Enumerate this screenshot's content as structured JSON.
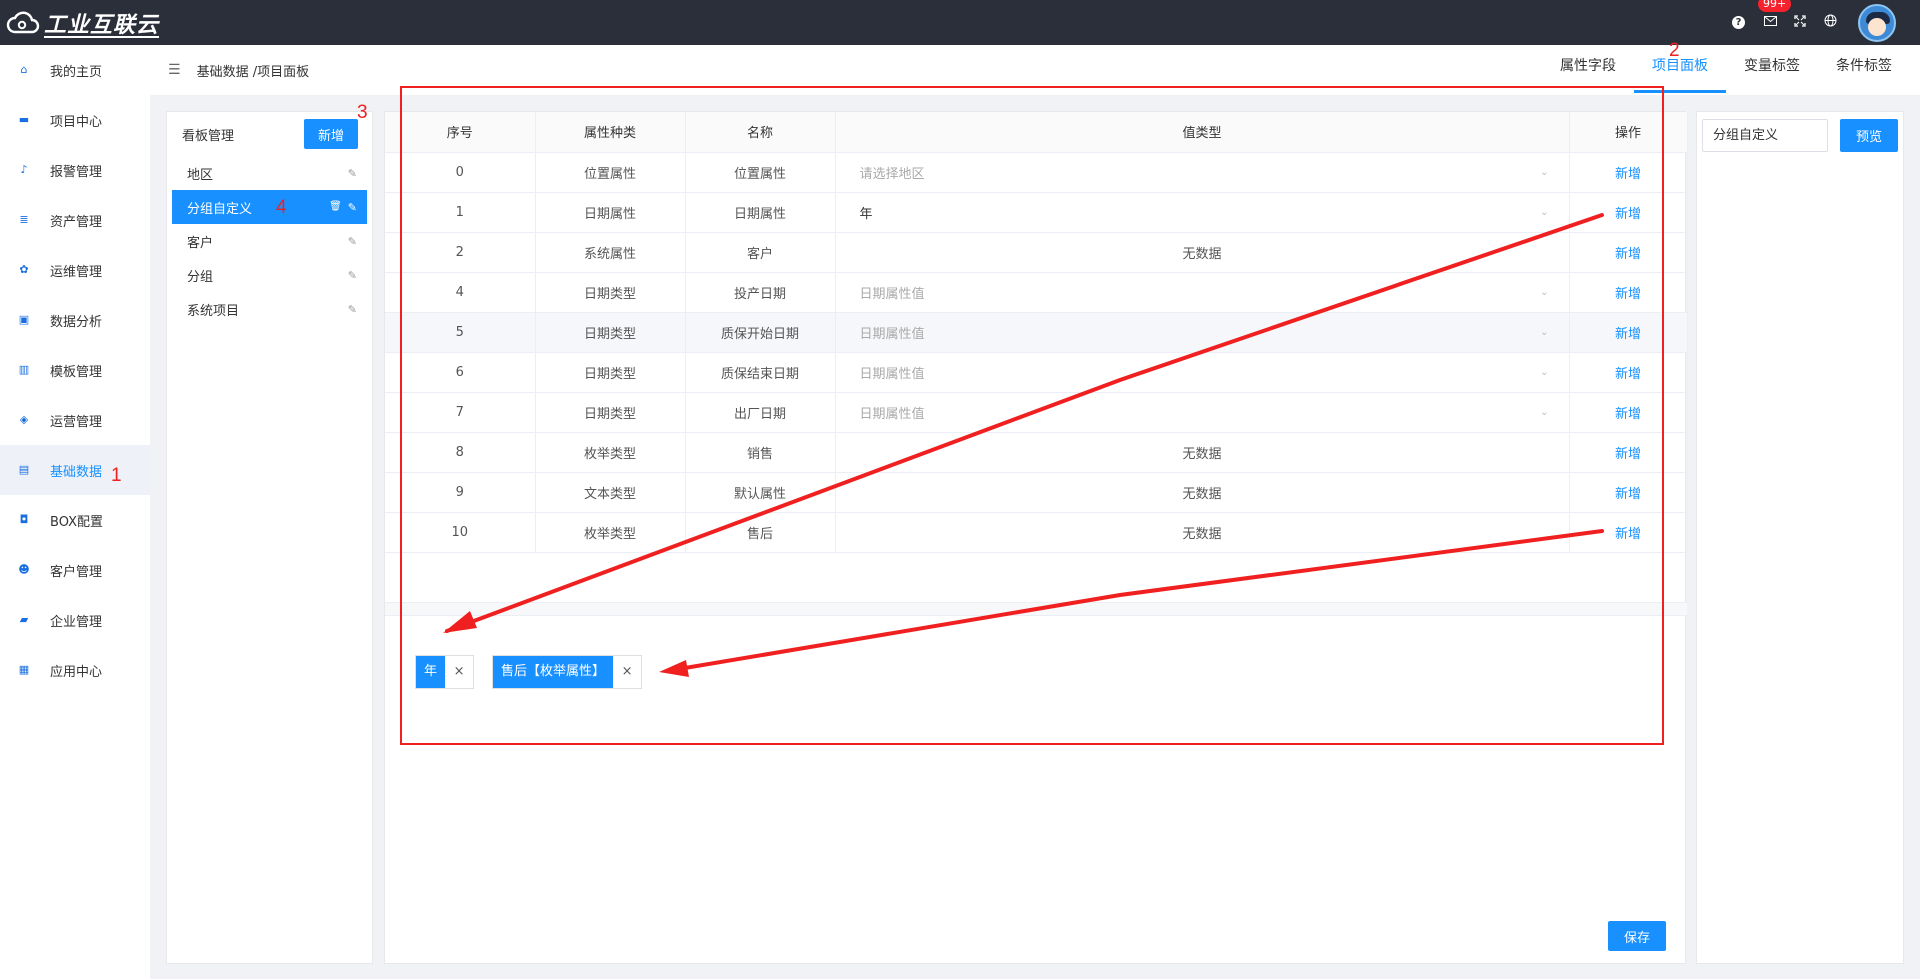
{
  "app": {
    "logo_text": "工业互联云"
  },
  "topbar": {
    "badge": "99+"
  },
  "sidebar": {
    "items": [
      {
        "label": "我的主页",
        "icon": "home-icon"
      },
      {
        "label": "项目中心",
        "icon": "box-icon"
      },
      {
        "label": "报警管理",
        "icon": "bell-icon"
      },
      {
        "label": "资产管理",
        "icon": "database-icon"
      },
      {
        "label": "运维管理",
        "icon": "gear-icon"
      },
      {
        "label": "数据分析",
        "icon": "monitor-chart-icon"
      },
      {
        "label": "模板管理",
        "icon": "template-icon"
      },
      {
        "label": "运营管理",
        "icon": "shield-icon"
      },
      {
        "label": "基础数据",
        "icon": "book-icon",
        "active": true
      },
      {
        "label": "BOX配置",
        "icon": "box-config-icon"
      },
      {
        "label": "客户管理",
        "icon": "users-icon"
      },
      {
        "label": "企业管理",
        "icon": "briefcase-icon"
      },
      {
        "label": "应用中心",
        "icon": "apps-icon"
      }
    ]
  },
  "header": {
    "breadcrumb": "基础数据 /项目面板",
    "tabs": [
      {
        "label": "属性字段"
      },
      {
        "label": "项目面板",
        "active": true
      },
      {
        "label": "变量标签"
      },
      {
        "label": "条件标签"
      }
    ]
  },
  "board": {
    "title": "看板管理",
    "add_label": "新增",
    "items": [
      {
        "label": "地区"
      },
      {
        "label": "分组自定义",
        "active": true
      },
      {
        "label": "客户"
      },
      {
        "label": "分组"
      },
      {
        "label": "系统项目"
      }
    ]
  },
  "table": {
    "columns": [
      "序号",
      "属性种类",
      "名称",
      "值类型",
      "操作"
    ],
    "rows": [
      {
        "idx": "0",
        "kind": "位置属性",
        "name": "位置属性",
        "value": "请选择地区",
        "value_style": "placeholder",
        "op": "新增"
      },
      {
        "idx": "1",
        "kind": "日期属性",
        "name": "日期属性",
        "value": "年",
        "value_style": "selected",
        "op": "新增"
      },
      {
        "idx": "2",
        "kind": "系统属性",
        "name": "客户",
        "value": "无数据",
        "value_style": "text",
        "op": "新增"
      },
      {
        "idx": "4",
        "kind": "日期类型",
        "name": "投产日期",
        "value": "日期属性值",
        "value_style": "placeholder",
        "op": "新增"
      },
      {
        "idx": "5",
        "kind": "日期类型",
        "name": "质保开始日期",
        "value": "日期属性值",
        "value_style": "placeholder",
        "op": "新增",
        "highlight": true
      },
      {
        "idx": "6",
        "kind": "日期类型",
        "name": "质保结束日期",
        "value": "日期属性值",
        "value_style": "placeholder",
        "op": "新增"
      },
      {
        "idx": "7",
        "kind": "日期类型",
        "name": "出厂日期",
        "value": "日期属性值",
        "value_style": "placeholder",
        "op": "新增"
      },
      {
        "idx": "8",
        "kind": "枚举类型",
        "name": "销售",
        "value": "无数据",
        "value_style": "text",
        "op": "新增"
      },
      {
        "idx": "9",
        "kind": "文本类型",
        "name": "默认属性",
        "value": "无数据",
        "value_style": "text",
        "op": "新增"
      },
      {
        "idx": "10",
        "kind": "枚举类型",
        "name": "售后",
        "value": "无数据",
        "value_style": "text",
        "op": "新增"
      }
    ]
  },
  "selected_tags": [
    {
      "label": "年",
      "close": "×"
    },
    {
      "label": "售后【枚举属性】",
      "close": "×"
    }
  ],
  "save_label": "保存",
  "preview": {
    "input_value": "分组自定义",
    "button_label": "预览"
  },
  "annotations": {
    "n1": "1",
    "n2": "2",
    "n3": "3",
    "n4": "4",
    "color": "#f02020"
  }
}
